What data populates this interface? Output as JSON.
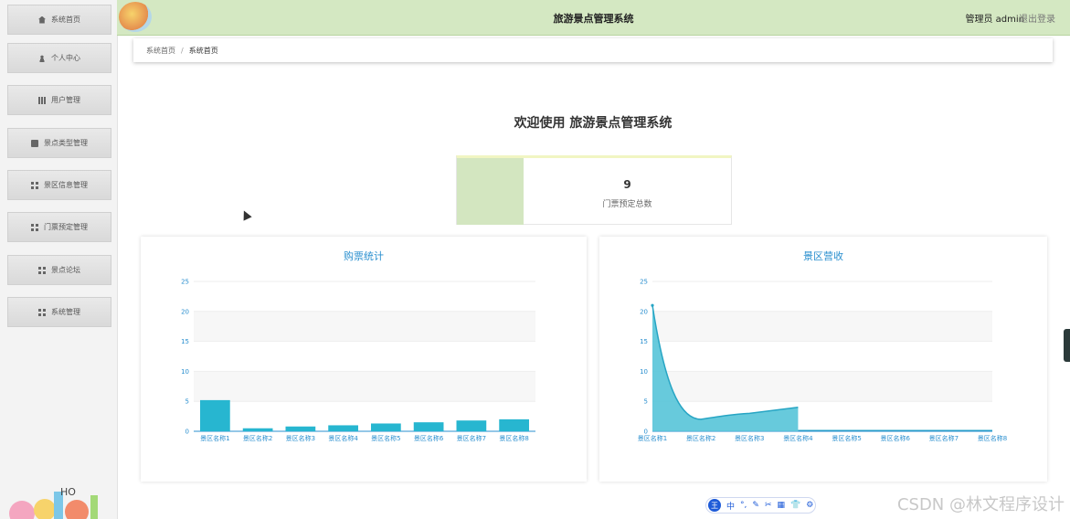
{
  "sidebar": {
    "items": [
      {
        "label": "系统首页",
        "icon": "home-icon"
      },
      {
        "label": "个人中心",
        "icon": "user-icon"
      },
      {
        "label": "用户管理",
        "icon": "bar-chart-icon"
      },
      {
        "label": "景点类型管理",
        "icon": "document-icon"
      },
      {
        "label": "景区信息管理",
        "icon": "grid-icon"
      },
      {
        "label": "门票预定管理",
        "icon": "grid-icon"
      },
      {
        "label": "景点论坛",
        "icon": "grid-icon"
      },
      {
        "label": "系统管理",
        "icon": "grid-icon"
      }
    ]
  },
  "header": {
    "title": "旅游景点管理系统",
    "admin": "管理员 admin",
    "logout": "退出登录",
    "bg_color": "#d4e8c2"
  },
  "breadcrumb": {
    "home": "系统首页",
    "separator": "/",
    "current": "系统首页"
  },
  "welcome": "欢迎使用 旅游景点管理系统",
  "stat": {
    "value": "9",
    "label": "门票预定总数",
    "color": "#d3e6c0"
  },
  "charts": {
    "tickets": {
      "title": "购票统计"
    },
    "revenue": {
      "title": "景区营收"
    }
  },
  "chart_data": [
    {
      "type": "bar",
      "title": "购票统计",
      "categories": [
        "景区名称1",
        "景区名称2",
        "景区名称3",
        "景区名称4",
        "景区名称5",
        "景区名称6",
        "景区名称7",
        "景区名称8"
      ],
      "values": [
        5.2,
        0.5,
        0.8,
        1.0,
        1.3,
        1.5,
        1.8,
        2.0
      ],
      "ylim": [
        0,
        25
      ],
      "yticks": [
        0,
        5,
        10,
        15,
        20,
        25
      ],
      "color": "#27b6d0"
    },
    {
      "type": "area",
      "title": "景区营收",
      "categories": [
        "景区名称1",
        "景区名称2",
        "景区名称3",
        "景区名称4",
        "景区名称5",
        "景区名称6",
        "景区名称7",
        "景区名称8"
      ],
      "values": [
        21,
        2,
        3,
        4,
        0,
        0,
        0,
        0
      ],
      "ylim": [
        0,
        25
      ],
      "yticks": [
        0,
        5,
        10,
        15,
        20,
        25
      ],
      "color": "#56c4d8"
    }
  ],
  "toolbar": {
    "logo": "王",
    "items": [
      "中",
      "°,",
      "✎",
      "✂",
      "▦",
      "👕",
      "⚙"
    ]
  },
  "watermark": "CSDN @林文程序设计"
}
